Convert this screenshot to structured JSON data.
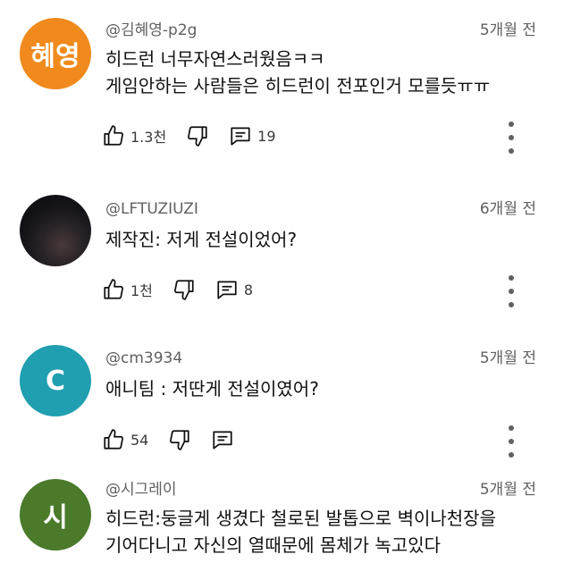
{
  "comments": [
    {
      "avatar_text": "혜영",
      "avatar_color": "#f08a1c",
      "author": "@김혜영-p2g",
      "time": "5개월 전",
      "lines": [
        "히드런 너무자연스러웠음ㅋㅋ",
        "게임안하는 사람들은 히드런이 전포인거 모를듯ㅠㅠ"
      ],
      "likes": "1.3천",
      "replies": "19"
    },
    {
      "avatar_text": "",
      "avatar_color": "#1a1a1e",
      "author": "@LFTUZIUZI",
      "time": "6개월 전",
      "lines": [
        "제작진: 저게 전설이었어?"
      ],
      "likes": "1천",
      "replies": "8"
    },
    {
      "avatar_text": "C",
      "avatar_color": "#1f9fb0",
      "author": "@cm3934",
      "time": "5개월 전",
      "lines": [
        "애니팀 : 저딴게 전설이였어?"
      ],
      "likes": "54",
      "replies": ""
    },
    {
      "avatar_text": "시",
      "avatar_color": "#4a7a2a",
      "author": "@시그레이",
      "time": "5개월 전",
      "lines": [
        "히드런:둥글게 생겼다 철로된 발톱으로 벽이나천장을",
        "기어다니고 자신의 열때문에 몸체가 녹고있다"
      ],
      "likes": "",
      "replies": ""
    }
  ],
  "icons": {
    "like": "thumbs-up-icon",
    "dislike": "thumbs-down-icon",
    "reply": "comment-icon",
    "more": "more-vert-icon"
  }
}
